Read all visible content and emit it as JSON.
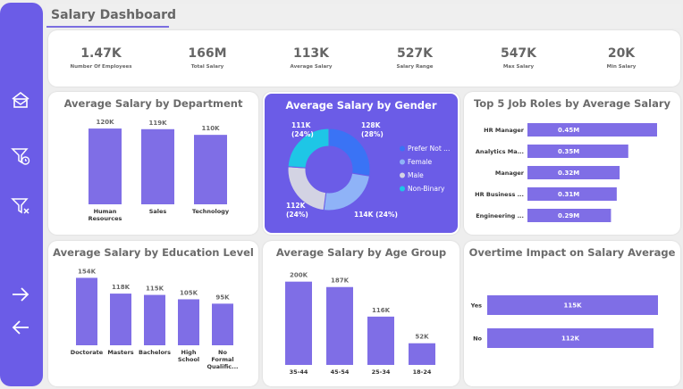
{
  "page_title": "Salary Dashboard",
  "sidebar": {
    "icons": [
      "home-icon",
      "filter-clock-icon",
      "filter-clear-icon",
      "arrow-right-icon",
      "arrow-left-icon"
    ]
  },
  "kpis": [
    {
      "value": "1.47K",
      "label": "Number Of Employees"
    },
    {
      "value": "166M",
      "label": "Total Salary"
    },
    {
      "value": "113K",
      "label": "Average Salary"
    },
    {
      "value": "527K",
      "label": "Salary Range"
    },
    {
      "value": "547K",
      "label": "Max Salary"
    },
    {
      "value": "20K",
      "label": "Min Salary"
    }
  ],
  "colors": {
    "bar": "#7f6ee6",
    "sidebar": "#6b5ce7",
    "gender_panel": "#6b5ce7",
    "pie": [
      "#3a73f5",
      "#8fb3f7",
      "#d3d3e3",
      "#1ec6e6"
    ]
  },
  "panels": {
    "department": {
      "title": "Average Salary by Department"
    },
    "gender": {
      "title": "Average Salary by Gender"
    },
    "roles": {
      "title": "Top 5 Job Roles by Average Salary"
    },
    "education": {
      "title": "Average Salary by Education Level"
    },
    "age": {
      "title": "Average Salary by Age Group"
    },
    "overtime": {
      "title": "Overtime Impact on Salary Average"
    }
  },
  "chart_data": [
    {
      "id": "department",
      "type": "bar",
      "title": "Average Salary by Department",
      "categories": [
        [
          "Human",
          "Resources"
        ],
        [
          "Sales"
        ],
        [
          "Technology"
        ]
      ],
      "values": [
        120,
        119,
        110
      ],
      "labels": [
        "120K",
        "119K",
        "110K"
      ],
      "ylim": [
        0,
        130
      ]
    },
    {
      "id": "gender",
      "type": "pie",
      "title": "Average Salary by Gender",
      "slices": [
        {
          "name": "Prefer Not ...",
          "value": 128,
          "pct": 28,
          "label": [
            "128K",
            "(28%)"
          ]
        },
        {
          "name": "Female",
          "value": 114,
          "pct": 24,
          "label": [
            "114K (24%)"
          ]
        },
        {
          "name": "Male",
          "value": 112,
          "pct": 24,
          "label": [
            "112K",
            "(24%)"
          ]
        },
        {
          "name": "Non-Binary",
          "value": 111,
          "pct": 24,
          "label": [
            "111K",
            "(24%)"
          ]
        }
      ]
    },
    {
      "id": "roles",
      "type": "bar",
      "orientation": "horizontal",
      "title": "Top 5 Job Roles by Average Salary",
      "categories": [
        "HR Manager",
        "Analytics Ma...",
        "Manager",
        "HR Business ...",
        "Engineering ..."
      ],
      "values": [
        0.45,
        0.35,
        0.32,
        0.31,
        0.29
      ],
      "labels": [
        "0.45M",
        "0.35M",
        "0.32M",
        "0.31M",
        "0.29M"
      ],
      "xlim": [
        0,
        0.45
      ]
    },
    {
      "id": "education",
      "type": "bar",
      "title": "Average Salary by Education Level",
      "categories": [
        [
          "Doctorate"
        ],
        [
          "Masters"
        ],
        [
          "Bachelors"
        ],
        [
          "High",
          "School"
        ],
        [
          "No",
          "Formal",
          "Qualific..."
        ]
      ],
      "values": [
        154,
        118,
        115,
        105,
        95
      ],
      "labels": [
        "154K",
        "118K",
        "115K",
        "105K",
        "95K"
      ],
      "ylim": [
        0,
        165
      ]
    },
    {
      "id": "age",
      "type": "bar",
      "title": "Average Salary by Age Group",
      "categories": [
        [
          "35-44"
        ],
        [
          "45-54"
        ],
        [
          "25-34"
        ],
        [
          "18-24"
        ]
      ],
      "values": [
        200,
        187,
        116,
        52
      ],
      "labels": [
        "200K",
        "187K",
        "116K",
        "52K"
      ],
      "ylim": [
        0,
        210
      ]
    },
    {
      "id": "overtime",
      "type": "bar",
      "orientation": "horizontal",
      "title": "Overtime Impact on Salary Average",
      "categories": [
        "Yes",
        "No"
      ],
      "values": [
        115,
        112
      ],
      "labels": [
        "115K",
        "112K"
      ],
      "xlim": [
        0,
        115
      ]
    }
  ]
}
